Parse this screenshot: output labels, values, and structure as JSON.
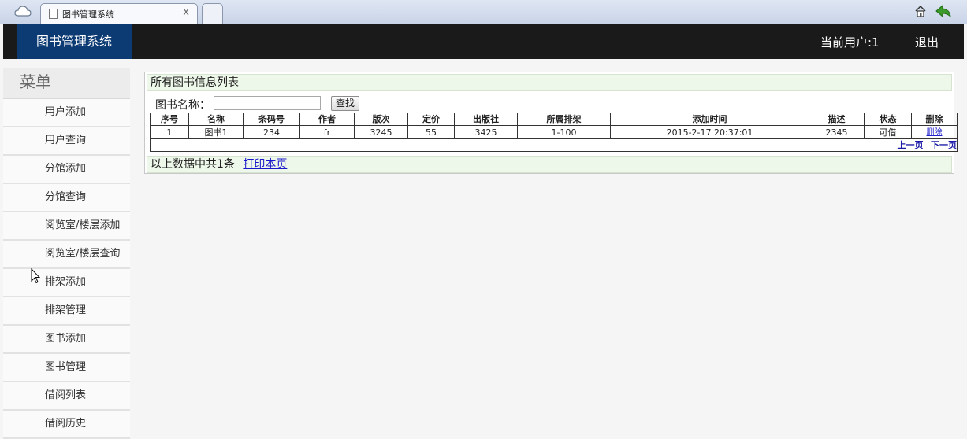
{
  "browser": {
    "tab_title": "图书管理系统",
    "tab_close": "x"
  },
  "header": {
    "brand": "图书管理系统",
    "current_user": "当前用户:1",
    "logout": "退出"
  },
  "sidebar": {
    "title": "菜单",
    "items": [
      {
        "label": "用户添加"
      },
      {
        "label": "用户查询"
      },
      {
        "label": "分馆添加"
      },
      {
        "label": "分馆查询"
      },
      {
        "label": "阅览室/楼层添加"
      },
      {
        "label": "阅览室/楼层查询"
      },
      {
        "label": "排架添加"
      },
      {
        "label": "排架管理"
      },
      {
        "label": "图书添加"
      },
      {
        "label": "图书管理"
      },
      {
        "label": "借阅列表"
      },
      {
        "label": "借阅历史"
      }
    ]
  },
  "main": {
    "panel_title": "所有图书信息列表",
    "search_label": "图书名称：",
    "search_value": "",
    "search_button": "查找",
    "columns": [
      "序号",
      "名称",
      "条码号",
      "作者",
      "版次",
      "定价",
      "出版社",
      "所属排架",
      "添加时间",
      "描述",
      "状态",
      "删除"
    ],
    "rows": [
      {
        "cells": [
          "1",
          "图书1",
          "234",
          "fr",
          "3245",
          "55",
          "3425",
          "1-100",
          "2015-2-17 20:37:01",
          "2345",
          "可借",
          "删除"
        ]
      }
    ],
    "prev_page": "上一页",
    "next_page": "下一页",
    "summary": "以上数据中共1条",
    "print_link": "打印本页"
  },
  "colors": {
    "header_bg": "#1a1a1a",
    "brand_bg": "#0c3a73",
    "panel_head_bg": "#eef8ea",
    "link": "#1a1acc"
  }
}
